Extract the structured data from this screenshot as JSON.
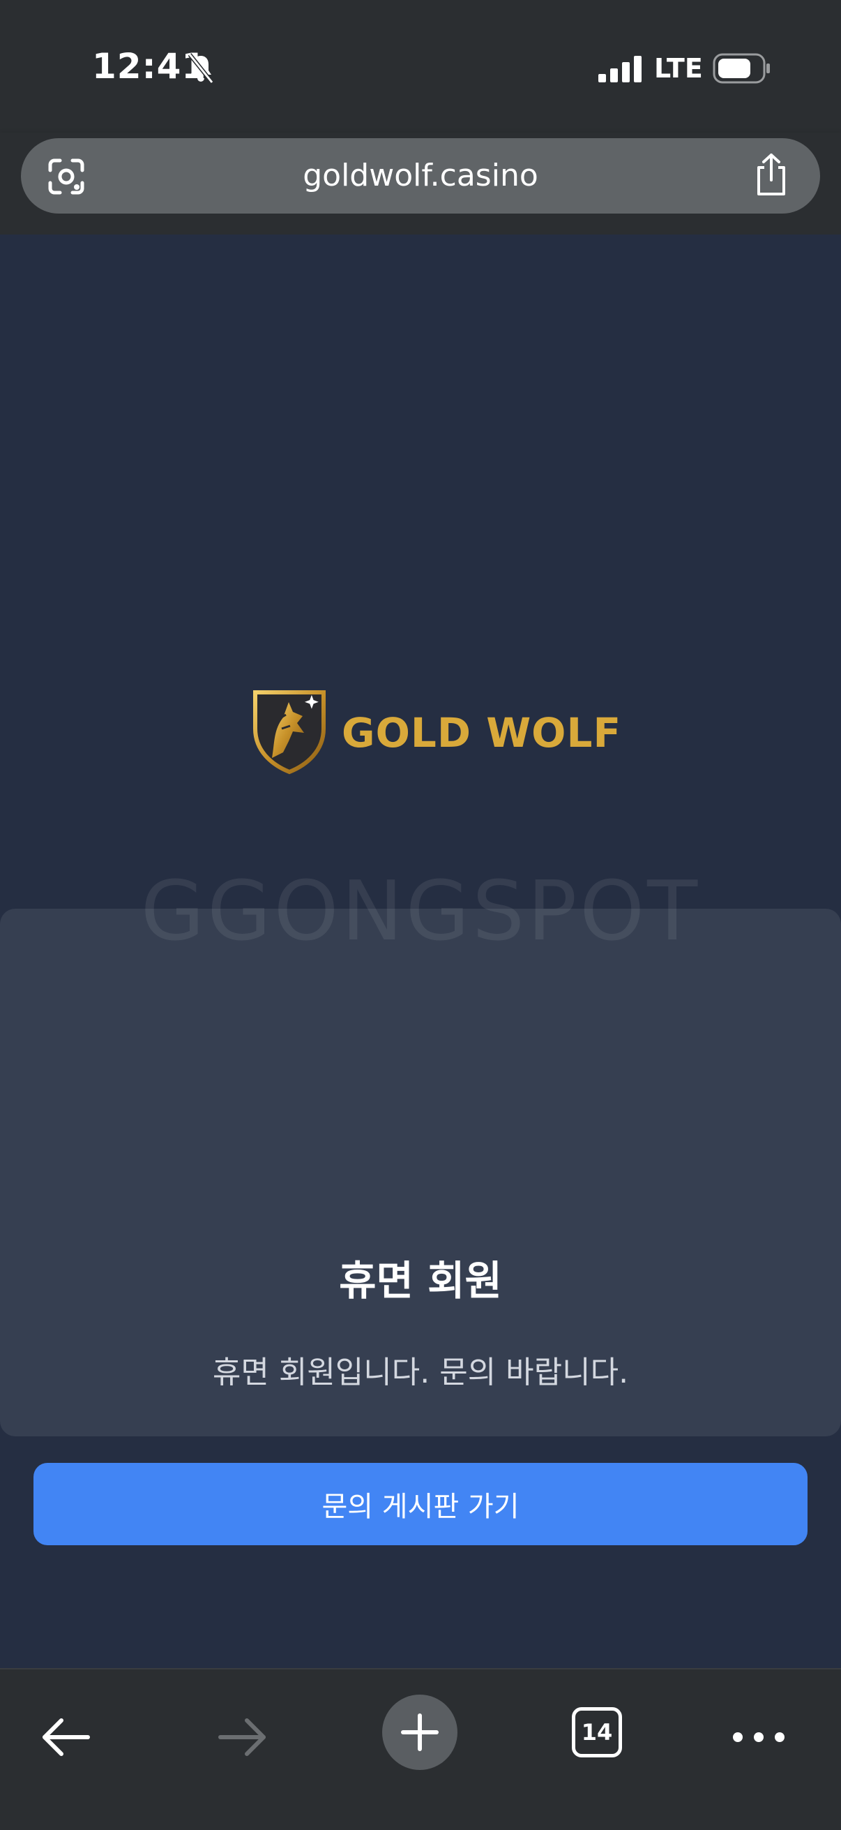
{
  "status_bar": {
    "time": "12:41",
    "network": "LTE",
    "icons": [
      "bell-slash-icon",
      "signal-icon",
      "battery-icon"
    ]
  },
  "browser": {
    "url": "goldwolf.casino",
    "tab_count": "14",
    "icons": [
      "lens-icon",
      "share-icon",
      "back-icon",
      "forward-icon",
      "plus-icon",
      "more-icon"
    ]
  },
  "page": {
    "brand": "GOLD WOLF",
    "watermark": "GGONGSPOT",
    "modal": {
      "title": "휴면 회원",
      "message": "휴면 회원입니다. 문의 바랍니다.",
      "button_label": "문의 게시판 가기"
    }
  },
  "colors": {
    "page_background": "#252e42",
    "modal_background": "#363f51",
    "button": "#4285f4",
    "brand_gold": "#d9a93a"
  }
}
